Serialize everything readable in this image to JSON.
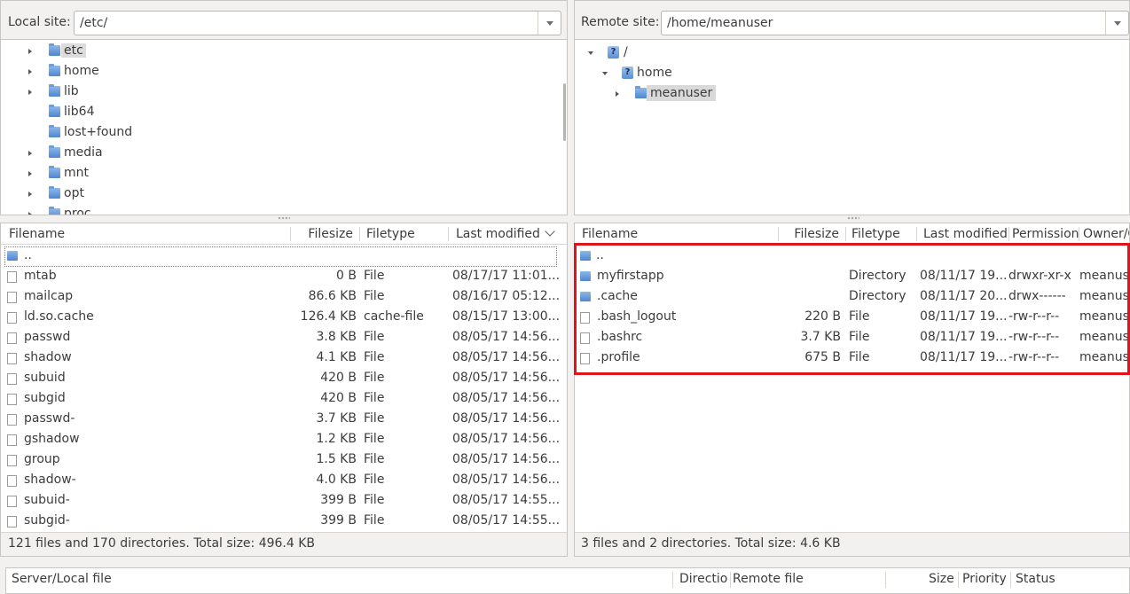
{
  "local": {
    "site_label": "Local site:",
    "path": "/etc/",
    "tree": [
      {
        "label": "etc",
        "expander": "closed",
        "selected": true
      },
      {
        "label": "home",
        "expander": "closed"
      },
      {
        "label": "lib",
        "expander": "closed"
      },
      {
        "label": "lib64",
        "expander": "none"
      },
      {
        "label": "lost+found",
        "expander": "none"
      },
      {
        "label": "media",
        "expander": "closed"
      },
      {
        "label": "mnt",
        "expander": "closed"
      },
      {
        "label": "opt",
        "expander": "closed"
      },
      {
        "label": "proc",
        "expander": "closed"
      }
    ],
    "columns": {
      "filename": "Filename",
      "filesize": "Filesize",
      "filetype": "Filetype",
      "last_modified": "Last modified"
    },
    "parent": "..",
    "files": [
      {
        "name": "mtab",
        "size": "0 B",
        "type": "File",
        "modified": "08/17/17 11:01..."
      },
      {
        "name": "mailcap",
        "size": "86.6 KB",
        "type": "File",
        "modified": "08/16/17 05:12..."
      },
      {
        "name": "ld.so.cache",
        "size": "126.4 KB",
        "type": "cache-file",
        "modified": "08/15/17 13:00..."
      },
      {
        "name": "passwd",
        "size": "3.8 KB",
        "type": "File",
        "modified": "08/05/17 14:56..."
      },
      {
        "name": "shadow",
        "size": "4.1 KB",
        "type": "File",
        "modified": "08/05/17 14:56..."
      },
      {
        "name": "subuid",
        "size": "420 B",
        "type": "File",
        "modified": "08/05/17 14:56..."
      },
      {
        "name": "subgid",
        "size": "420 B",
        "type": "File",
        "modified": "08/05/17 14:56..."
      },
      {
        "name": "passwd-",
        "size": "3.7 KB",
        "type": "File",
        "modified": "08/05/17 14:56..."
      },
      {
        "name": "gshadow",
        "size": "1.2 KB",
        "type": "File",
        "modified": "08/05/17 14:56..."
      },
      {
        "name": "group",
        "size": "1.5 KB",
        "type": "File",
        "modified": "08/05/17 14:56..."
      },
      {
        "name": "shadow-",
        "size": "4.0 KB",
        "type": "File",
        "modified": "08/05/17 14:56..."
      },
      {
        "name": "subuid-",
        "size": "399 B",
        "type": "File",
        "modified": "08/05/17 14:55..."
      },
      {
        "name": "subgid-",
        "size": "399 B",
        "type": "File",
        "modified": "08/05/17 14:55..."
      }
    ],
    "status": "121 files and 170 directories. Total size: 496.4 KB"
  },
  "remote": {
    "site_label": "Remote site:",
    "path": "/home/meanuser",
    "tree": [
      {
        "label": "/",
        "expander": "open",
        "icon": "question-folder-icon"
      },
      {
        "label": "home",
        "expander": "open",
        "icon": "question-folder-icon"
      },
      {
        "label": "meanuser",
        "expander": "closed",
        "icon": "folder-icon",
        "selected": true
      }
    ],
    "columns": {
      "filename": "Filename",
      "filesize": "Filesize",
      "filetype": "Filetype",
      "last_modified": "Last modified",
      "permissions": "Permission",
      "owner": "Owner/G"
    },
    "parent": "..",
    "files": [
      {
        "name": "myfirstapp",
        "size": "",
        "type": "Directory",
        "modified": "08/11/17 19...",
        "perm": "drwxr-xr-x",
        "owner": "meanus",
        "dir": true
      },
      {
        "name": ".cache",
        "size": "",
        "type": "Directory",
        "modified": "08/11/17 20...",
        "perm": "drwx------",
        "owner": "meanus",
        "dir": true
      },
      {
        "name": ".bash_logout",
        "size": "220 B",
        "type": "File",
        "modified": "08/11/17 19...",
        "perm": "-rw-r--r--",
        "owner": "meanus",
        "dir": false
      },
      {
        "name": ".bashrc",
        "size": "3.7 KB",
        "type": "File",
        "modified": "08/11/17 19...",
        "perm": "-rw-r--r--",
        "owner": "meanus",
        "dir": false
      },
      {
        "name": ".profile",
        "size": "675 B",
        "type": "File",
        "modified": "08/11/17 19...",
        "perm": "-rw-r--r--",
        "owner": "meanus",
        "dir": false
      }
    ],
    "status": "3 files and 2 directories. Total size: 4.6 KB"
  },
  "queue": {
    "server_local": "Server/Local file",
    "direction": "Directio",
    "remote_file": "Remote file",
    "size": "Size",
    "priority": "Priority",
    "status": "Status"
  },
  "colors": {
    "highlight": "#e0141c",
    "folder": "#4d86d1",
    "background": "#f2f1f0"
  }
}
